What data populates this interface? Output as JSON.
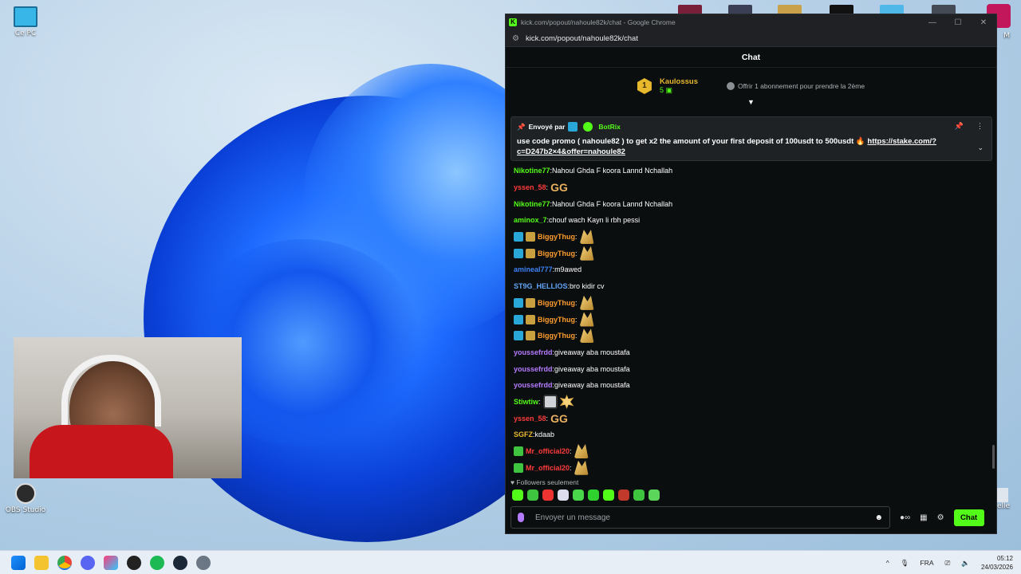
{
  "desktop": {
    "icons": [
      {
        "label": "Ce PC"
      },
      {
        "label": "OBS Studio"
      },
      {
        "label": "elle"
      },
      {
        "label": "M"
      }
    ]
  },
  "window": {
    "title": "kick.com/popout/nahoule82k/chat - Google Chrome",
    "url": "kick.com/popout/nahoule82k/chat"
  },
  "chat": {
    "header": "Chat",
    "leaderboard": {
      "rank": "1",
      "user": "Kaulossus",
      "count": "5",
      "offer": "Offrir 1 abonnement pour prendre la 2ème"
    },
    "pinned": {
      "sent_by": "Envoyé par",
      "bot": "BotRix",
      "text": "use code promo ( nahoule82 ) to get x2 the amount of your first deposit of 100usdt to 500usdt",
      "link": "https://stake.com/?c=D247b2×4&offer=nahoule82"
    },
    "messages": [
      {
        "user": "Nikotine77",
        "color": "#53fc18",
        "text": "Nahoul Ghda F koora Lannd Nchallah",
        "badges": []
      },
      {
        "user": "yssen_58",
        "color": "#ff3b3b",
        "text": "",
        "emote": "GG",
        "badges": []
      },
      {
        "user": "Nikotine77",
        "color": "#53fc18",
        "text": "Nahoul Ghda F koora Lannd Nchallah",
        "badges": []
      },
      {
        "user": "aminox_7",
        "color": "#53fc18",
        "text": "chouf wach Kayn li rbh pessi",
        "badges": []
      },
      {
        "user": "BiggyThug",
        "color": "#ff9d2e",
        "text": "",
        "emote": "wing",
        "badges": [
          "#2aa7d9",
          "#c8a040"
        ]
      },
      {
        "user": "BiggyThug",
        "color": "#ff9d2e",
        "text": "",
        "emote": "wing",
        "badges": [
          "#2aa7d9",
          "#c8a040"
        ]
      },
      {
        "user": "amineal777",
        "color": "#3b82f6",
        "text": "m9awed",
        "badges": []
      },
      {
        "user": "ST9G_HELLIOS",
        "color": "#60a5fa",
        "text": "bro kidir cv",
        "badges": []
      },
      {
        "user": "BiggyThug",
        "color": "#ff9d2e",
        "text": "",
        "emote": "wing",
        "badges": [
          "#2aa7d9",
          "#c8a040"
        ]
      },
      {
        "user": "BiggyThug",
        "color": "#ff9d2e",
        "text": "",
        "emote": "wing",
        "badges": [
          "#2aa7d9",
          "#c8a040"
        ]
      },
      {
        "user": "BiggyThug",
        "color": "#ff9d2e",
        "text": "",
        "emote": "wing",
        "badges": [
          "#2aa7d9",
          "#c8a040"
        ]
      },
      {
        "user": "youssefrdd",
        "color": "#b57bff",
        "text": "giveaway aba moustafa",
        "badges": []
      },
      {
        "user": "youssefrdd",
        "color": "#b57bff",
        "text": "giveaway aba moustafa",
        "badges": []
      },
      {
        "user": "youssefrdd",
        "color": "#b57bff",
        "text": "giveaway aba moustafa",
        "badges": []
      },
      {
        "user": "Stiwtiw",
        "color": "#53fc18",
        "text": "",
        "emote": "face",
        "badges": []
      },
      {
        "user": "yssen_58",
        "color": "#ff3b3b",
        "text": "",
        "emote": "GG",
        "badges": []
      },
      {
        "user": "SGFZ",
        "color": "#e8b92c",
        "text": "kdaab",
        "badges": []
      },
      {
        "user": "Mr_official20",
        "color": "#ff3b3b",
        "text": "",
        "emote": "wing",
        "badges": [
          "#3ec43e"
        ]
      },
      {
        "user": "Mr_official20",
        "color": "#ff3b3b",
        "text": "",
        "emote": "wing",
        "badges": [
          "#3ec43e"
        ]
      }
    ],
    "followers_only": "Followers seulement",
    "input_placeholder": "Envoyer un message",
    "send_label": "Chat"
  },
  "taskbar": {
    "language": "FRA",
    "time": "05:12",
    "date": "24/03/2026"
  },
  "colors": {
    "kick_green": "#53fc18",
    "chat_bg": "#0b0e0f"
  }
}
